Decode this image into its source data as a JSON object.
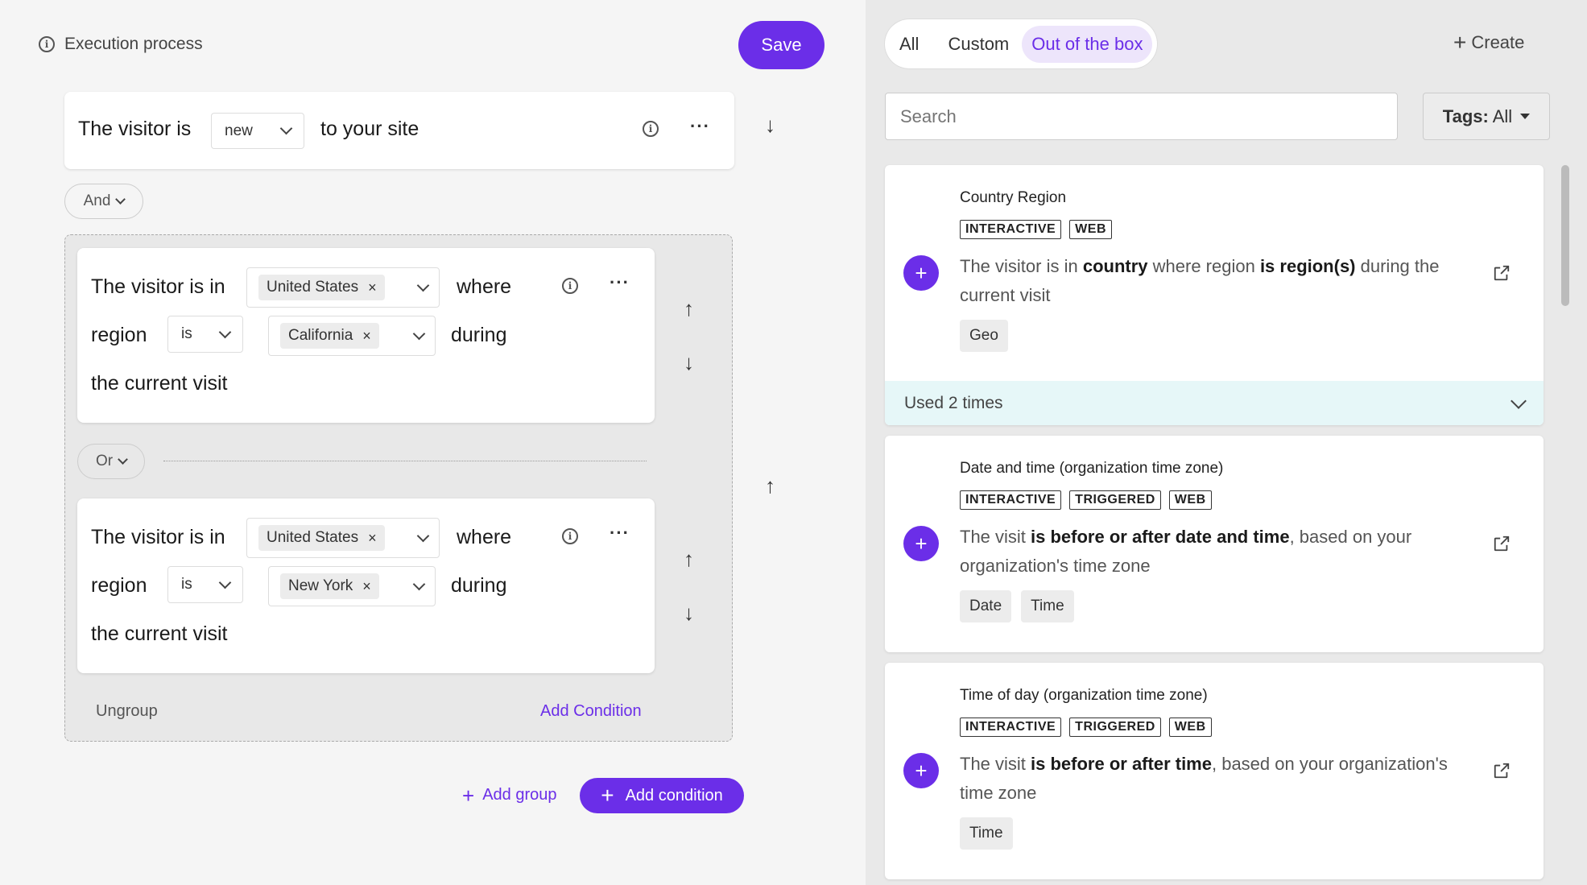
{
  "left": {
    "title": "Execution process",
    "save_label": "Save",
    "condition1": {
      "prefix": "The visitor is",
      "select_value": "new",
      "suffix": "to your site"
    },
    "and_label": "And",
    "group": {
      "cond_a": {
        "prefix": "The visitor is in",
        "country_chip": "United States",
        "where": "where",
        "region": "region",
        "operator": "is",
        "region_chip": "California",
        "during": "during",
        "tail": "the current visit"
      },
      "or_label": "Or",
      "cond_b": {
        "prefix": "The visitor is in",
        "country_chip": "United States",
        "where": "where",
        "region": "region",
        "operator": "is",
        "region_chip": "New York",
        "during": "during",
        "tail": "the current visit"
      },
      "ungroup_label": "Ungroup",
      "add_condition_link": "Add Condition"
    },
    "add_group_label": "Add group",
    "add_condition_label": "Add condition"
  },
  "right": {
    "tabs": [
      {
        "label": "All"
      },
      {
        "label": "Custom"
      },
      {
        "label": "Out of the box"
      }
    ],
    "create_label": "Create",
    "search_placeholder": "Search",
    "tags_label": "Tags:",
    "tags_value": "All",
    "cards": [
      {
        "title": "Country Region",
        "tags": [
          "INTERACTIVE",
          "WEB"
        ],
        "desc_1": "The visitor is in ",
        "desc_b1": "country",
        "desc_2": " where region ",
        "desc_b2": "is region(s)",
        "desc_3": " during the current visit",
        "groups": [
          "Geo"
        ],
        "used": "Used 2 times"
      },
      {
        "title": "Date and time (organization time zone)",
        "tags": [
          "INTERACTIVE",
          "TRIGGERED",
          "WEB"
        ],
        "desc_1": "The visit ",
        "desc_b1": "is before or after date and time",
        "desc_2": ", based on your organization's time zone",
        "groups": [
          "Date",
          "Time"
        ]
      },
      {
        "title": "Time of day (organization time zone)",
        "tags": [
          "INTERACTIVE",
          "TRIGGERED",
          "WEB"
        ],
        "desc_1": "The visit ",
        "desc_b1": "is before or after time",
        "desc_2": ", based on your organization's time zone",
        "groups": [
          "Time"
        ]
      }
    ]
  },
  "colors": {
    "accent": "#6b2ee8",
    "used_bg": "#e6f7f8"
  }
}
